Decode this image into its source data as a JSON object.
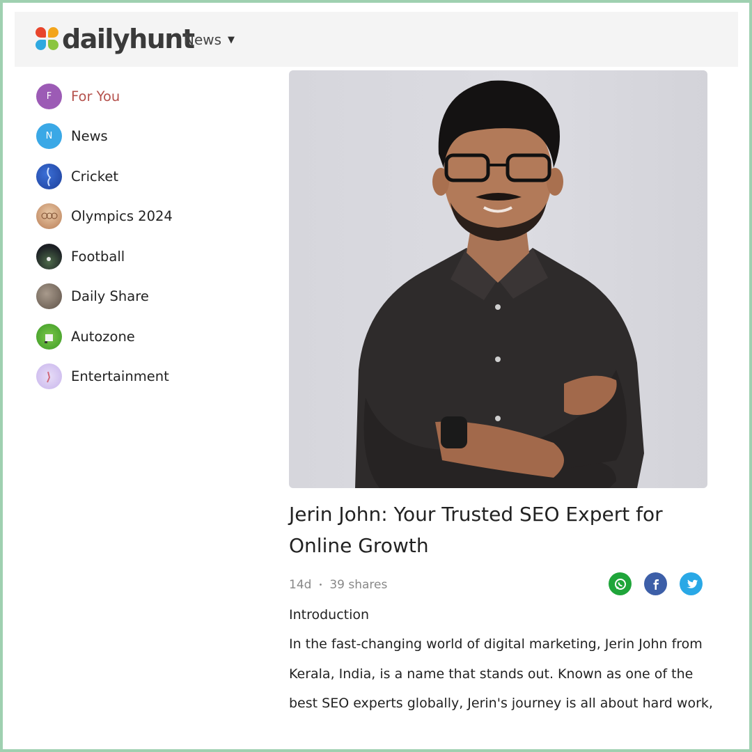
{
  "header": {
    "logo_text": "dailyhunt",
    "nav_label": "News"
  },
  "sidebar": {
    "items": [
      {
        "label": "For You",
        "icon_letter": "F",
        "icon_color": "#9c5bb5",
        "active": true
      },
      {
        "label": "News",
        "icon_letter": "N",
        "icon_color": "#3aa8e6"
      },
      {
        "label": "Cricket",
        "icon": "cricket-thumbnail"
      },
      {
        "label": "Olympics 2024",
        "icon": "olympics-thumbnail"
      },
      {
        "label": "Football",
        "icon": "football-thumbnail"
      },
      {
        "label": "Daily Share",
        "icon": "daily-share-thumbnail"
      },
      {
        "label": "Autozone",
        "icon": "autozone-thumbnail"
      },
      {
        "label": "Entertainment",
        "icon": "entertainment-thumbnail"
      }
    ]
  },
  "article": {
    "headline": "Jerin John: Your Trusted SEO Expert for Online Growth",
    "age": "14d",
    "shares": "39 shares",
    "section_heading": "Introduction",
    "body": "In the fast-changing world of digital marketing, Jerin John from Kerala, India, is a name that stands out. Known as one of the best SEO experts globally, Jerin's journey is all about hard work,"
  },
  "share_icons": [
    "whatsapp-icon",
    "facebook-icon",
    "twitter-icon"
  ],
  "colors": {
    "accent_active": "#b5524d",
    "whatsapp": "#1fa53a",
    "facebook": "#3d5fa8",
    "twitter": "#29a8e6",
    "border": "#9fd0b0"
  }
}
